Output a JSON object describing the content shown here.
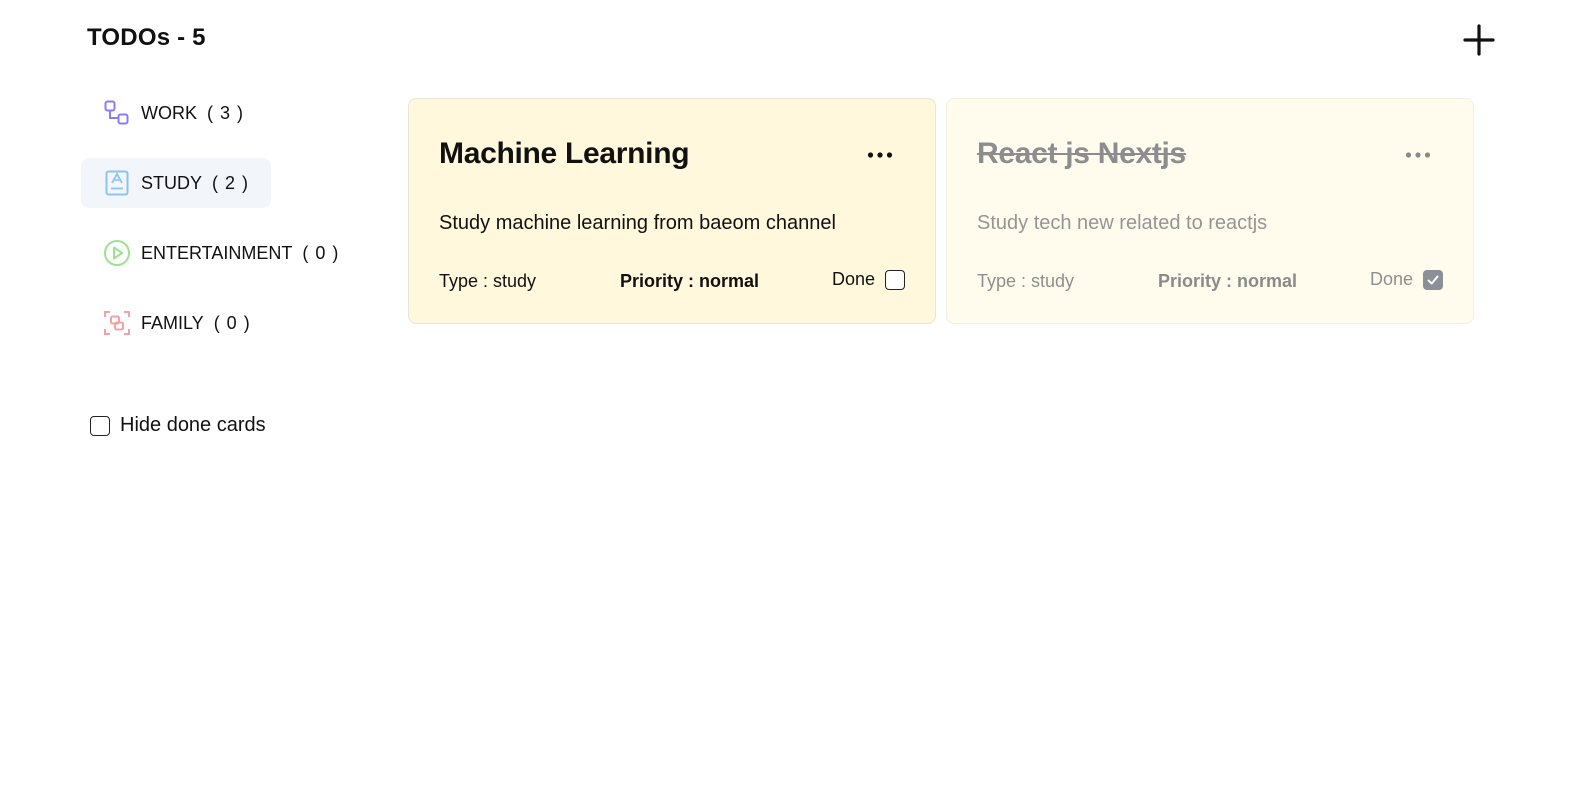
{
  "header": {
    "title": "TODOs - 5",
    "add_icon": "plus-icon"
  },
  "sidebar": {
    "items": [
      {
        "label": "WORK",
        "count": "( 3 )",
        "icon": "work-icon",
        "color": "#8b7cf0",
        "active": false
      },
      {
        "label": "STUDY",
        "count": "( 2 )",
        "icon": "book-icon",
        "color": "#8cc4f2",
        "active": true
      },
      {
        "label": "ENTERTAINMENT",
        "count": "( 0 )",
        "icon": "play-icon",
        "color": "#9be38f",
        "active": false
      },
      {
        "label": "FAMILY",
        "count": "( 0 )",
        "icon": "family-icon",
        "color": "#f4a3a3",
        "active": false
      }
    ],
    "hide_done_label": "Hide done cards",
    "hide_done_checked": false
  },
  "cards": [
    {
      "title": "Machine Learning",
      "description": "Study machine learning from baeom channel",
      "type": "Type : study",
      "priority": "Priority : normal",
      "done_label": "Done",
      "done": false,
      "background": "#fff8dc"
    },
    {
      "title": "React js Nextjs",
      "description": "Study tech new related to reactjs",
      "type": "Type : study",
      "priority": "Priority : normal",
      "done_label": "Done",
      "done": true,
      "background": "#fffcee"
    }
  ]
}
